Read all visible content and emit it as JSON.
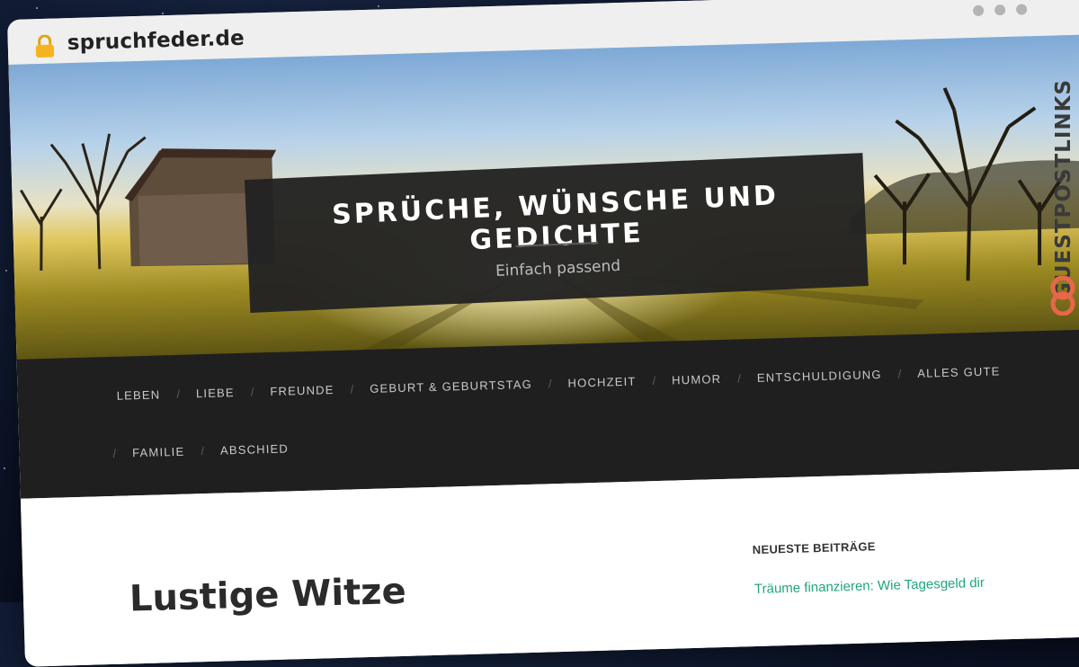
{
  "browser": {
    "url": "spruchfeder.de",
    "lock_icon": "lock-icon",
    "window_controls": [
      "dot",
      "dot",
      "dot"
    ]
  },
  "site": {
    "title": "SPRÜCHE, WÜNSCHE UND GEDICHTE",
    "tagline": "Einfach passend"
  },
  "nav": {
    "row1": [
      {
        "label": "LEBEN"
      },
      {
        "label": "LIEBE"
      },
      {
        "label": "FREUNDE"
      },
      {
        "label": "GEBURT & GEBURTSTAG"
      },
      {
        "label": "HOCHZEIT"
      },
      {
        "label": "HUMOR"
      },
      {
        "label": "ENTSCHULDIGUNG"
      },
      {
        "label": "ALLES GUTE"
      }
    ],
    "row2": [
      {
        "label": "FAMILIE"
      },
      {
        "label": "ABSCHIED"
      }
    ],
    "separator": "/"
  },
  "main": {
    "post_title": "Lustige Witze"
  },
  "sidebar": {
    "widget_title": "NEUESTE BEITRÄGE",
    "recent_posts": [
      "Träume finanzieren: Wie Tagesgeld dir"
    ]
  },
  "watermark": {
    "text": "GUESTPOSTLINKS",
    "icon": "link-icon"
  },
  "colors": {
    "nav_bg": "#1f1f1f",
    "title_box_bg": "#222222",
    "link": "#1fa57d",
    "watermark_accent": "#e8664a"
  }
}
